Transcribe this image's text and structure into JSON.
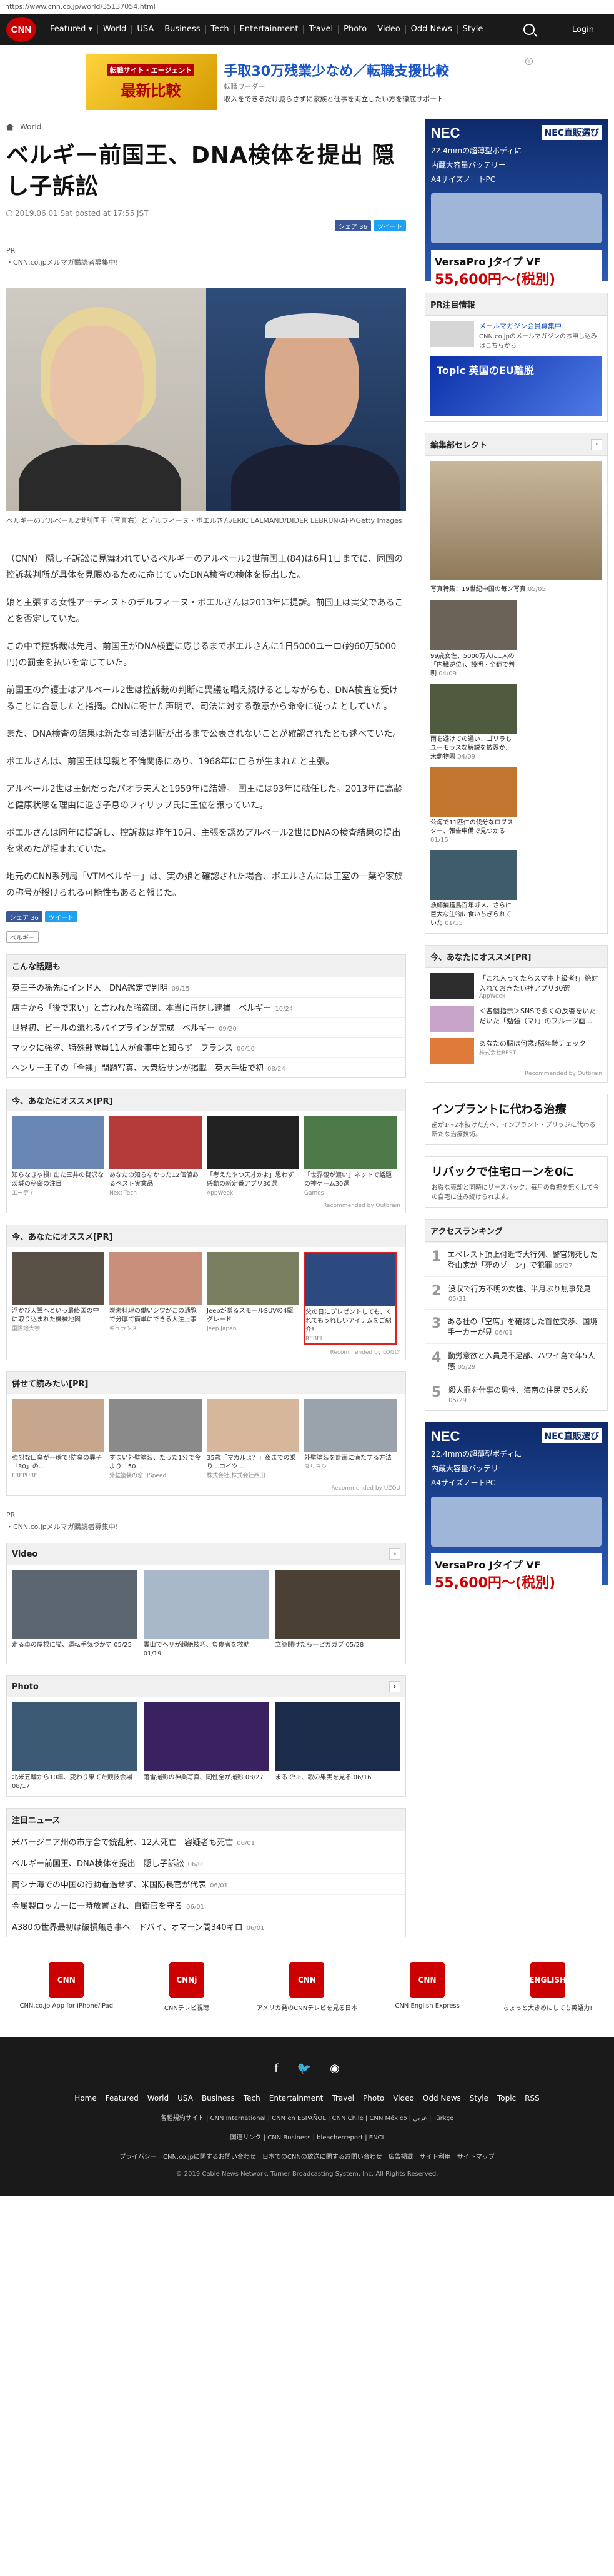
{
  "url": "https://www.cnn.co.jp/world/35137054.html",
  "nav": {
    "logo": "CNN",
    "items": [
      "Featured ▾",
      "World",
      "USA",
      "Business",
      "Tech",
      "Entertainment",
      "Travel",
      "Photo",
      "Video",
      "Odd News",
      "Style"
    ],
    "login": "Login"
  },
  "ad_top": {
    "img_line1": "転職サイト・エージェント",
    "img_line2": "最新比較",
    "headline": "手取30万残業少なめ／転職支援比較",
    "sponsor": "転職ワーダー",
    "desc": "収入をできるだけ減らさずに家族と仕事を両立したい方を徹底サポート"
  },
  "breadcrumb": "World",
  "article": {
    "title": "ベルギー前国王、DNA検体を提出 隠し子訴訟",
    "date": "2019.06.01 Sat posted at 17:55 JST",
    "share_fb": "シェア 36",
    "share_tw": "ツイート",
    "pr": "PR",
    "pr_link": "・CNN.co.jpメルマガ購読者募集中!",
    "caption": "ベルギーのアルベール2世前国王（写真右）とデルフィーヌ・ボエルさん/ERIC LALMAND/DIDER LEBRUN/AFP/Getty Images",
    "paragraphs": [
      "（CNN） 隠し子訴訟に見舞われているベルギーのアルベール2世前国王(84)は6月1日までに、同国の控訴裁判所が具体を見限めるために命じていたDNA検査の検体を提出した。",
      "娘と主張する女性アーティストのデルフィーヌ・ボエルさんは2013年に提訴。前国王は実父であることを否定していた。",
      "この中で控訴裁は先月、前国王がDNA検査に応じるまでボエルさんに1日5000ユーロ(約60万5000円)の罰金を払いを命じていた。",
      "前国王の弁護士はアルベール2世は控訴裁の判断に異議を唱え続けるとしながらも、DNA検査を受けることに合意したと指摘。CNNに寄せた声明で、司法に対する敬意から命令に従ったとしていた。",
      "また、DNA検査の結果は新たな司法判断が出るまで公表されないことが確認されたとも述べていた。",
      "ボエルさんは、前国王は母親と不倫関係にあり、1968年に自らが生まれたと主張。",
      "アルベール2世は王妃だったパオラ夫人と1959年に結婚。 国王には93年に就任した。2013年に高齢と健康状態を理由に退き子息のフィリップ氏に王位を譲っていた。",
      "ボエルさんは同年に提訴し、控訴裁は昨年10月、主張を認めアルベール2世にDNAの検査結果の提出を求めたが拒まれていた。",
      "地元のCNN系列局「VTMベルギー」は、実の娘と確認された場合、ボエルさんには王室の一葉や家族の称号が授けられる可能性もあると報じた。"
    ],
    "tag": "ベルギー"
  },
  "related": {
    "title": "こんな話題も",
    "items": [
      {
        "text": "英王子の孫先にインド人　DNA鑑定で判明",
        "date": "09/15"
      },
      {
        "text": "店主から「後で来い」と言われた強盗団、本当に再訪し逮捕　ベルギー",
        "date": "10/24"
      },
      {
        "text": "世界初、ビールの流れるパイプラインが完成　ベルギー",
        "date": "09/20"
      },
      {
        "text": "マックに強盗、特殊部隊員11人が食事中と知らず　フランス",
        "date": "06/10"
      },
      {
        "text": "ヘンリー王子の「全裸」問題写真、大衆紙サンが掲載　英大手紙で初",
        "date": "08/24"
      }
    ]
  },
  "rec1": {
    "title": "今、あなたにオススメ[PR]",
    "items": [
      {
        "text": "知らなきゃ損! 出た三井の贅沢な茨城の秘密の注目",
        "src": "エーディ"
      },
      {
        "text": "あなたの知らなかった12価値あるベスト実業品",
        "src": "Next Tech"
      },
      {
        "text": "「考えたやつ天才かよ」思わず感動の新定番アプリ30選",
        "src": "AppWeek"
      },
      {
        "text": "「世界観が濃い」ネットで話題の神ゲーム30選",
        "src": "Games"
      }
    ],
    "by": "Recommended by Outbrain"
  },
  "rec2": {
    "title": "今、あなたにオススメ[PR]",
    "items": [
      {
        "text": "浮かび天翼へといっ最終国の中に取り込まれた機械地図",
        "src": "国際地大学"
      },
      {
        "text": "炭素料理の働いシワがこの通覧で分厚て簡単にできる大注上事",
        "src": "キュランス"
      },
      {
        "text": "Jeepが贈るスモールSUVの4駆グレード",
        "src": "Jeep Japan"
      },
      {
        "text": "父の日にプレゼントしても、くれてもうれしいアイテムをご紹介!",
        "src": "REBEL"
      }
    ],
    "by": "Recommended by LOGLY"
  },
  "rec3": {
    "title": "併せて読みたい[PR]",
    "items": [
      {
        "text": "強烈な口臭が一瞬で!防臭の異子「30」の…",
        "src": "FREPURE"
      },
      {
        "text": "すまい外壁塗装、たった1分で今より「50…",
        "src": "外壁塗装の窓口Speed"
      },
      {
        "text": "35歳「マカルよ？」夜までの乗り…コイツ…",
        "src": "株式会社(株式会社西田"
      },
      {
        "text": "外壁塗装を計画に満たする方法",
        "src": "ヌリヨシ"
      }
    ],
    "by": "Recommended by UZOU"
  },
  "pr2": "PR",
  "pr2_link": "・CNN.co.jpメルマガ購読者募集中!",
  "video": {
    "title": "Video",
    "items": [
      {
        "text": "走る車の屋根に猫、運転手気づかず",
        "date": "05/25"
      },
      {
        "text": "雲山でヘリが超絶技巧、負傷者を救助",
        "date": "01/19"
      },
      {
        "text": "立簡開けたら一ピガガブ",
        "date": "05/28"
      }
    ]
  },
  "photo": {
    "title": "Photo",
    "items": [
      {
        "text": "北米五輪から10年、変わり果てた競技会場",
        "date": "08/17"
      },
      {
        "text": "落雷撮影の神業写真、同性全が撮影",
        "date": "08/27"
      },
      {
        "text": "まるでSF、歌の果実を見る",
        "date": "06/16"
      }
    ]
  },
  "news": {
    "title": "注目ニュース",
    "items": [
      {
        "text": "米バージニア州の市庁舎で銃乱射、12人死亡　容疑者も死亡",
        "date": "06/01"
      },
      {
        "text": "ベルギー前国王、DNA検体を提出　隠し子訴訟",
        "date": "06/01"
      },
      {
        "text": "南シナ海での中国の行動看過せず、米国防長官が代表",
        "date": "06/01"
      },
      {
        "text": "金属製ロッカーに一時放置され、自衛官を守る",
        "date": "06/01"
      },
      {
        "text": "A380の世界最初は破損無き事へ　ドバイ、オマーン間340キロ",
        "date": "06/01"
      }
    ]
  },
  "side": {
    "nec_brand": "NEC",
    "nec_sel": "NEC直販選び",
    "nec_line1": "22.4mmの超薄型ボディに",
    "nec_line2": "内蔵大容量バッテリー",
    "nec_line3": "A4サイズノートPC",
    "nec_product": "VersaPro Jタイプ VF",
    "nec_price": "55,600円〜(税別)",
    "pr_info": "PR注目情報",
    "pr_info_text": "メールマガジン会員募集中",
    "pr_info_sub": "CNN.co.jpのメールマガジンのお申し込みはこちらから",
    "topic_text": "Topic 英国のEU離脱",
    "editor": "編集部セレクト",
    "big_caption": "写真特集：19世紀中国の毎ン写真",
    "big_date": "05/05",
    "grid": [
      {
        "text": "99歳女性、5000万人に1人の「内臓逆位」、設明・全翻で判明",
        "date": "04/09"
      },
      {
        "text": "雨を避けての通い、ゴリラもユーモラスな解説を披露か、米動物園",
        "date": "04/09"
      },
      {
        "text": "公海で11匹仁の伐分なロブスター、報告申備で見つかる",
        "date": "01/15"
      },
      {
        "text": "漁師捕獲鳥百年ガメ、さらに巨大な生物に食いちぎられていた",
        "date": "01/15"
      }
    ],
    "rec_title": "今、あなたにオススメ[PR]",
    "rec_items": [
      {
        "text": "「これ入ってたらスマホ上級者!」絶対入れておきたい神アプリ30選",
        "src": "AppWeek"
      },
      {
        "text": "＜各個指示＞SNSで多くの反響をいただいた「勉強（マ）」のフルーツ画…",
        "src": ""
      },
      {
        "text": "あなたの脳は何歳?脳年齢チェック",
        "src": "株式会社BEST"
      }
    ],
    "rec_by": "Recommended by Outbrain",
    "ad2_title": "インプラントに代わる治療",
    "ad2_desc": "歯が1～2本抜けた方へ、インプラント・ブリッジに代わる新たな治療技術。",
    "ad3_title": "リバックで住宅ローンを0に",
    "ad3_desc": "お得な売却と同時にリースバック。毎月の負担を無くして今の自宅に住み続けられます。",
    "rank_title": "アクセスランキング",
    "rank": [
      "エベレスト頂上付近で大行列、警官殉死した登山家が「死のゾーン」で犯罪",
      "没収で行方不明の女性、半月ぶり無事発見",
      "ある社の「空席」を確認した首位交渉、国境手一カーが見",
      "勤労意欲と入員見不足部、ハワイ島で年5人感",
      "殺人罪を仕事の男性、海南の住民で5人殺"
    ],
    "rank_dates": [
      "05/27",
      "05/31",
      "06/01",
      "05/29",
      "05/29"
    ]
  },
  "footapps": [
    {
      "logo": "CNN",
      "text": "CNN.co.jp App for iPhone/iPad"
    },
    {
      "logo": "CNNj",
      "text": "CNNテレビ視聴"
    },
    {
      "logo": "CNN",
      "text": "アメリカ発のCNNテレビを見る日本"
    },
    {
      "logo": "CNN",
      "text": "CNN English Express"
    },
    {
      "logo": "ENGLISH",
      "text": "ちょっと大きめにしても英語力!"
    }
  ],
  "footer": {
    "nav": [
      "Home",
      "Featured",
      "World",
      "USA",
      "Business",
      "Tech",
      "Entertainment",
      "Travel",
      "Photo",
      "Video",
      "Odd News",
      "Style",
      "Topic",
      "RSS"
    ],
    "links1": "各種規約サイト | CNN International | CNN en ESPAÑOL | CNN Chile | CNN México | عربي | Türkçe",
    "links2": "国連リンク | CNN Business | bleacherreport | ENCI",
    "links3": "プライバシー　CNN.co.jpに関するお問い合わせ　日本でのCNNの放送に関するお問い合わせ　広告掲載　サイト利用　サイトマップ",
    "copy": "© 2019 Cable News Network. Turner Broadcasting System, Inc. All Rights Reserved."
  }
}
